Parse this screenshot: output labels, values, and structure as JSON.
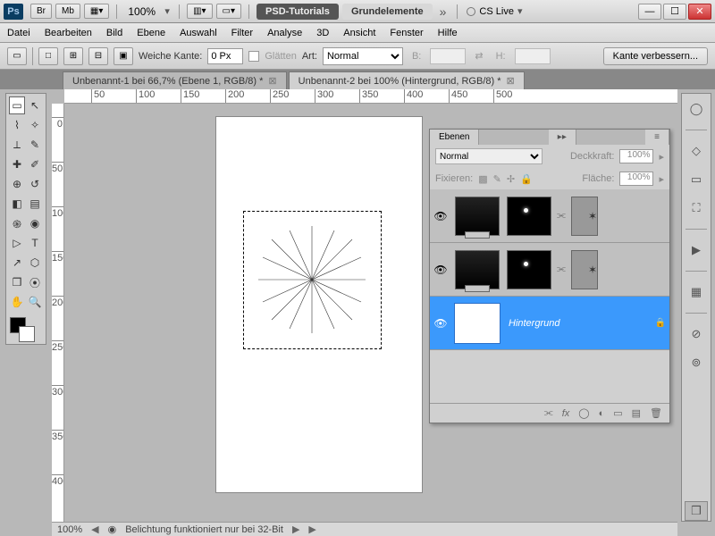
{
  "titlebar": {
    "br": "Br",
    "mb": "Mb",
    "zoom": "100%",
    "tab1": "PSD-Tutorials",
    "tab2": "Grundelemente",
    "cslive": "CS Live"
  },
  "menu": [
    "Datei",
    "Bearbeiten",
    "Bild",
    "Ebene",
    "Auswahl",
    "Filter",
    "Analyse",
    "3D",
    "Ansicht",
    "Fenster",
    "Hilfe"
  ],
  "options": {
    "feather_label": "Weiche Kante:",
    "feather_value": "0 Px",
    "antialias_label": "Glätten",
    "style_label": "Art:",
    "style_value": "Normal",
    "w_label": "B:",
    "h_label": "H:",
    "refine": "Kante verbessern..."
  },
  "doctabs": [
    {
      "title": "Unbenannt-1 bei 66,7% (Ebene 1, RGB/8) *"
    },
    {
      "title": "Unbenannt-2 bei 100% (Hintergrund, RGB/8) *"
    }
  ],
  "ruler_h": [
    50,
    100,
    150,
    200,
    250,
    300,
    350,
    400,
    450,
    500
  ],
  "ruler_v": [
    0,
    50,
    100,
    150,
    200,
    250,
    300,
    350,
    400
  ],
  "layers_panel": {
    "tab": "Ebenen",
    "blend": "Normal",
    "opacity_label": "Deckkraft:",
    "opacity": "100%",
    "lock_label": "Fixieren:",
    "fill_label": "Fläche:",
    "fill": "100%",
    "bg_name": "Hintergrund"
  },
  "status": {
    "zoom": "100%",
    "msg": "Belichtung funktioniert nur bei 32-Bit"
  }
}
